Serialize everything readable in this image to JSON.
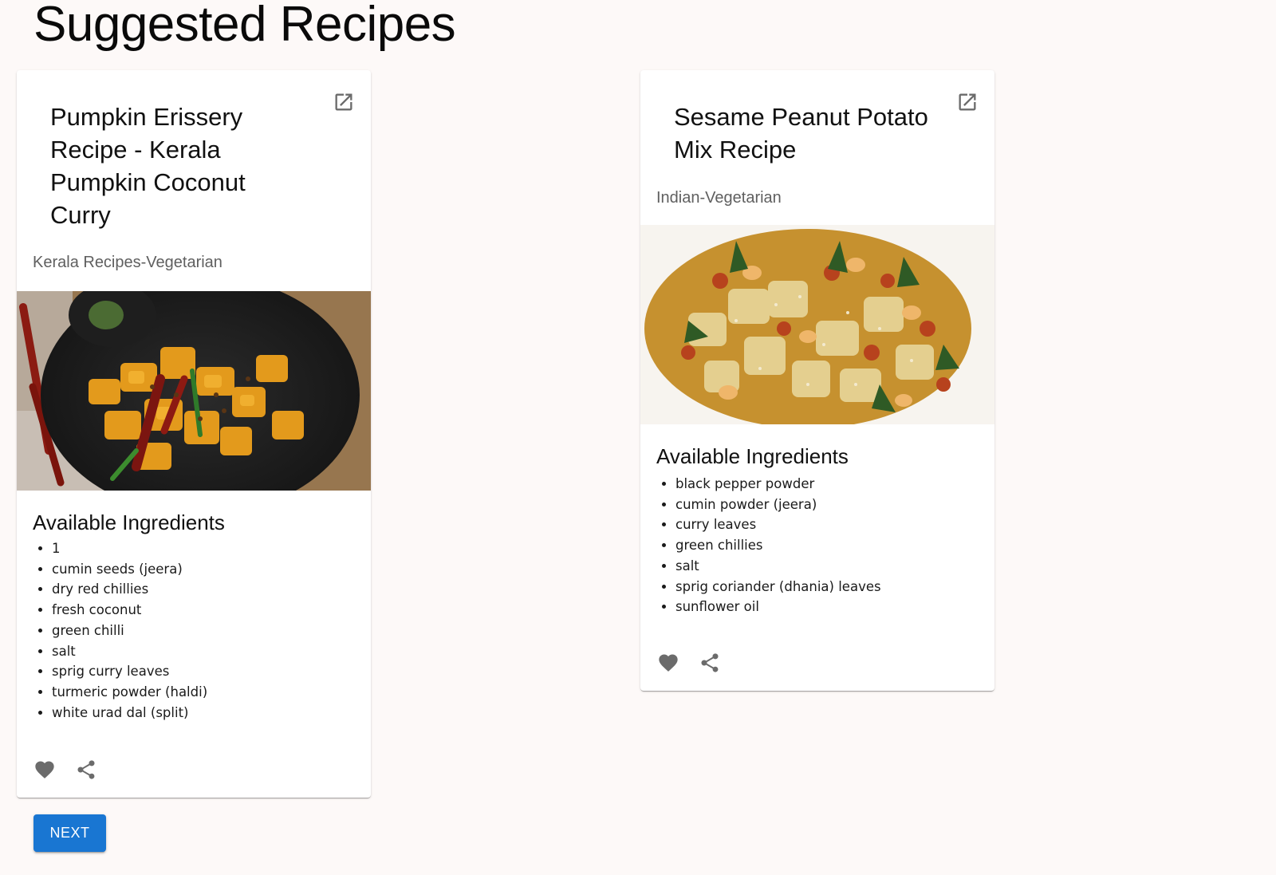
{
  "page": {
    "title": "Suggested Recipes"
  },
  "recipes": [
    {
      "title": "Pumpkin Erissery Recipe - Kerala Pumpkin Coconut Curry",
      "category": "Kerala Recipes-Vegetarian",
      "image_icon": "pumpkin-curry-photo",
      "ingredients_heading": "Available Ingredients",
      "ingredients": [
        "1",
        "cumin seeds (jeera)",
        "dry red chillies",
        "fresh coconut",
        "green chilli",
        "salt",
        "sprig curry leaves",
        "turmeric powder (haldi)",
        "white urad dal (split)"
      ],
      "actions": {
        "open_icon": "open-in-new-icon",
        "favorite_icon": "heart-icon",
        "share_icon": "share-icon"
      }
    },
    {
      "title": "Sesame Peanut Potato Mix Recipe",
      "category": "Indian-Vegetarian",
      "image_icon": "sesame-peanut-potato-photo",
      "ingredients_heading": "Available Ingredients",
      "ingredients": [
        "black pepper powder",
        "cumin powder (jeera)",
        "curry leaves",
        "green chillies",
        "salt",
        "sprig coriander (dhania) leaves",
        "sunflower oil"
      ],
      "actions": {
        "open_icon": "open-in-new-icon",
        "favorite_icon": "heart-icon",
        "share_icon": "share-icon"
      }
    }
  ],
  "pagination": {
    "next_label": "NEXT"
  },
  "colors": {
    "background": "#fdf9f8",
    "primary": "#1976d2",
    "icon": "#6b6b6b",
    "subheader": "#5f5f5f"
  }
}
